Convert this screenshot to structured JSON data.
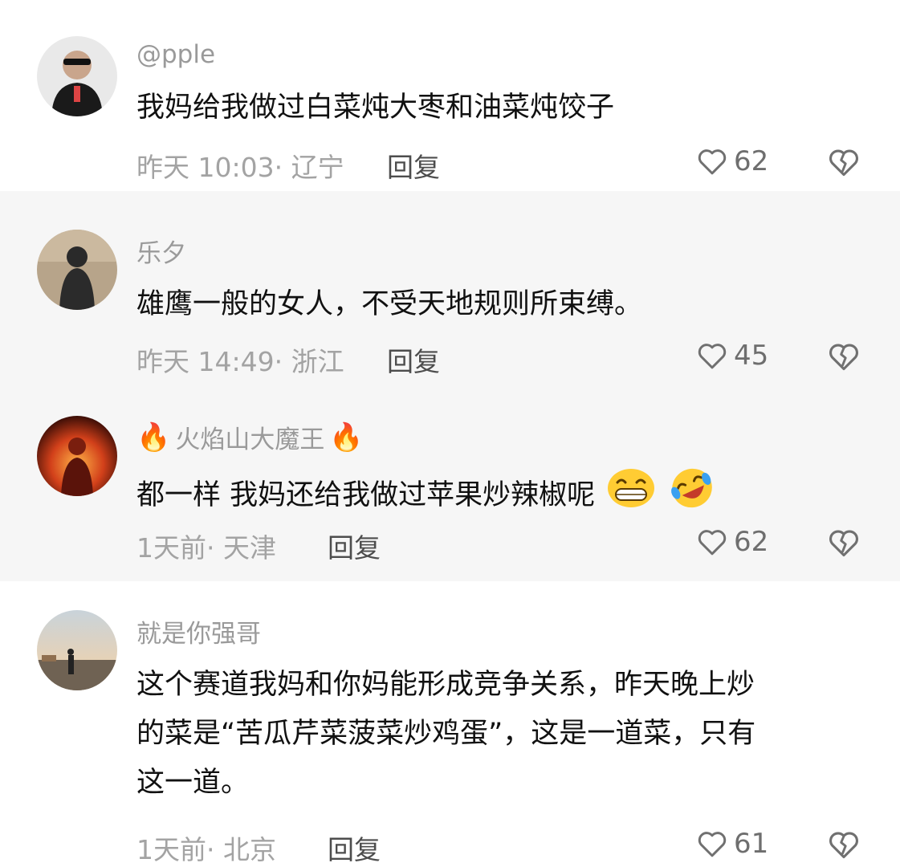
{
  "comments": [
    {
      "username": "@pple",
      "text": "我妈给我做过白菜炖大枣和油菜炖饺子",
      "time": "昨天 10:03",
      "location": "· 辽宁",
      "reply_label": "回复",
      "likes": "62"
    },
    {
      "username": "乐夕",
      "text": "雄鹰一般的女人，不受天地规则所束缚。",
      "time": "昨天 14:49",
      "location": "· 浙江",
      "reply_label": "回复",
      "likes": "45"
    },
    {
      "username": "火焰山大魔王",
      "username_icons": [
        "fire-emoji",
        "fire-emoji"
      ],
      "text": "都一样 我妈还给我做过苹果炒辣椒呢",
      "text_emojis": [
        "grinning-emoji",
        "rolling-laughing-emoji"
      ],
      "time": "1天前",
      "location": "· 天津",
      "reply_label": "回复",
      "likes": "62"
    },
    {
      "username": "就是你强哥",
      "text_lines": [
        "这个赛道我妈和你妈能形成竞争关系，昨天晚上炒",
        "的菜是“苦瓜芹菜菠菜炒鸡蛋”，这是一道菜，只有",
        "这一道。"
      ],
      "time": "1天前",
      "location": "· 北京",
      "reply_label": "回复",
      "likes": "61"
    }
  ],
  "icons": {
    "like": "heart-outline-icon",
    "dislike": "broken-heart-icon"
  },
  "colors": {
    "username": "#9a9a9a",
    "text": "#111111",
    "meta": "#a3a3a3",
    "reply": "#4d4d4d",
    "alt_background": "#f6f6f6"
  }
}
